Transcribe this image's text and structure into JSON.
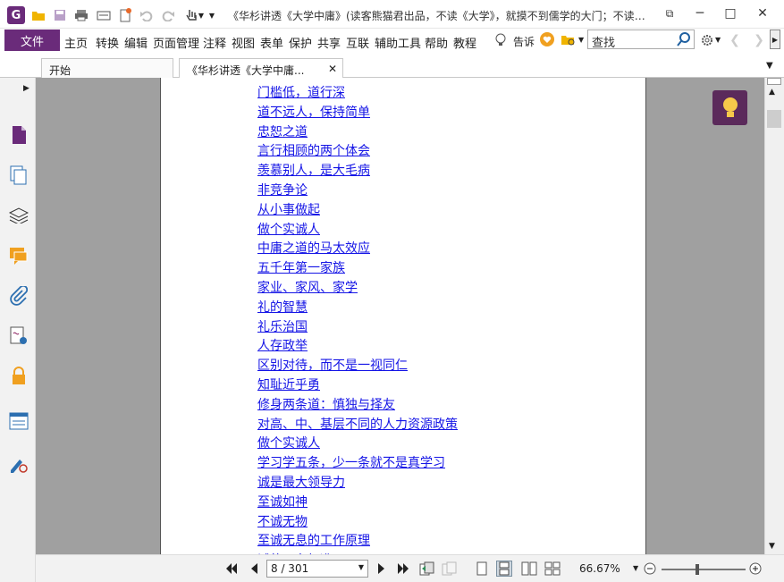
{
  "window": {
    "title": "《华杉讲透《大学中庸》(读客熊猫君出品，不读《大学》，就摸不到儒学的大门；不读《中...",
    "min_label": "─",
    "max_label": "□",
    "close_label": "✕",
    "restore_label": "⧉"
  },
  "menu": {
    "file_label": "文件",
    "items": [
      "主页",
      "转换",
      "编辑",
      "页面管理",
      "注释",
      "视图",
      "表单",
      "保护",
      "共享",
      "互联",
      "辅助工具",
      "帮助",
      "教程"
    ],
    "tell_label": "告诉",
    "search_placeholder": "查找"
  },
  "tabs": [
    {
      "label": "开始"
    },
    {
      "label": "《华杉讲透《大学中庸...",
      "close": "✕"
    }
  ],
  "document": {
    "links": [
      "门槛低，道行深",
      "道不远人，保持简单",
      "忠恕之道",
      "言行相顾的两个体会",
      "羡慕别人，是大毛病",
      "非竞争论",
      "从小事做起",
      "做个实诚人",
      "中庸之道的马太效应",
      "五千年第一家族",
      "家业、家风、家学",
      "礼的智慧",
      "礼乐治国",
      "人存政举",
      "区别对待，而不是一视同仁",
      "知耻近乎勇",
      "修身两条道：慎独与择友",
      "对高、中、基层不同的人力资源政策",
      "做个实诚人",
      "学习学五条，少一条就不是真学习",
      "诚是最大领导力",
      "至诚如神",
      "不诚无物",
      "至诚无息的工作原理",
      "诚的平台标准"
    ]
  },
  "status": {
    "page_value": "8 / 301",
    "zoom_value": "66.67%",
    "zoom_level": 0.42
  },
  "colors": {
    "accent": "#6a2b7a",
    "link": "#1515e6",
    "viewer_bg": "#a0a0a0",
    "tip_bg": "#5b2a5b"
  }
}
